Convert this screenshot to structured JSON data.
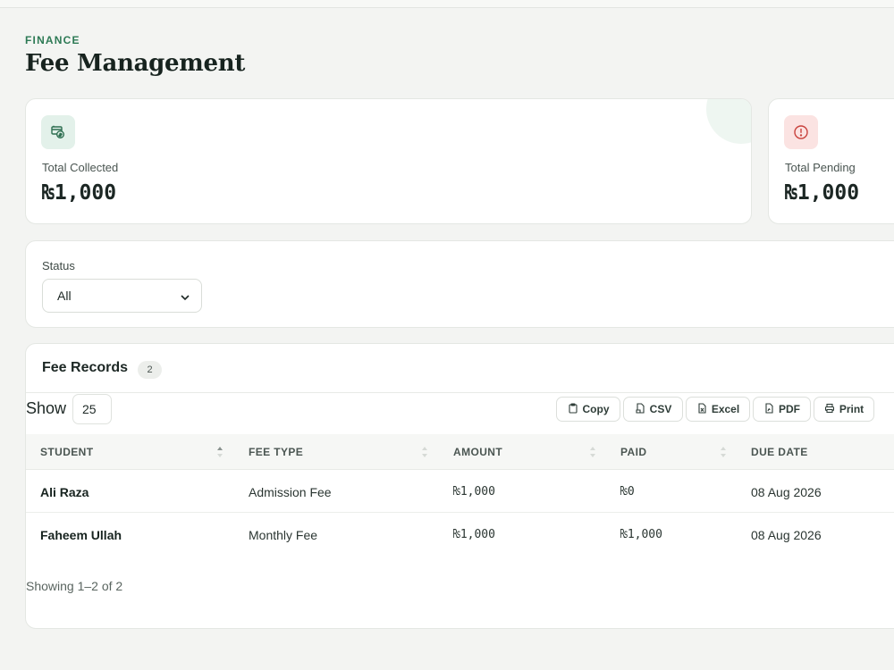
{
  "header": {
    "section_label": "FINANCE",
    "title": "Fee Management"
  },
  "stats": [
    {
      "label": "Total Collected",
      "value": "₨1,000",
      "icon": "money-receipt-icon",
      "color": "#2d7a55"
    },
    {
      "label": "Total Pending",
      "value": "₨1,000",
      "icon": "alert-circle-icon",
      "color": "#d9534f"
    }
  ],
  "filter": {
    "label": "Status",
    "selected": "All"
  },
  "records": {
    "title": "Fee Records",
    "count": "2",
    "show_label": "Show",
    "page_size": "25",
    "exports": [
      {
        "label": "Copy",
        "icon": "clipboard-icon"
      },
      {
        "label": "CSV",
        "icon": "file-csv-icon"
      },
      {
        "label": "Excel",
        "icon": "file-excel-icon"
      },
      {
        "label": "PDF",
        "icon": "file-pdf-icon"
      },
      {
        "label": "Print",
        "icon": "printer-icon"
      }
    ],
    "columns": [
      "STUDENT",
      "FEE TYPE",
      "AMOUNT",
      "PAID",
      "DUE DATE"
    ],
    "rows": [
      {
        "student": "Ali Raza",
        "fee_type": "Admission Fee",
        "amount": "₨1,000",
        "paid": "₨0",
        "due_date": "08 Aug 2026"
      },
      {
        "student": "Faheem Ullah",
        "fee_type": "Monthly Fee",
        "amount": "₨1,000",
        "paid": "₨1,000",
        "due_date": "08 Aug 2026"
      }
    ],
    "showing": "Showing 1–2 of 2"
  },
  "colors": {
    "accent": "#2d7a55",
    "danger": "#d9534f",
    "background": "#f3f4f2"
  }
}
